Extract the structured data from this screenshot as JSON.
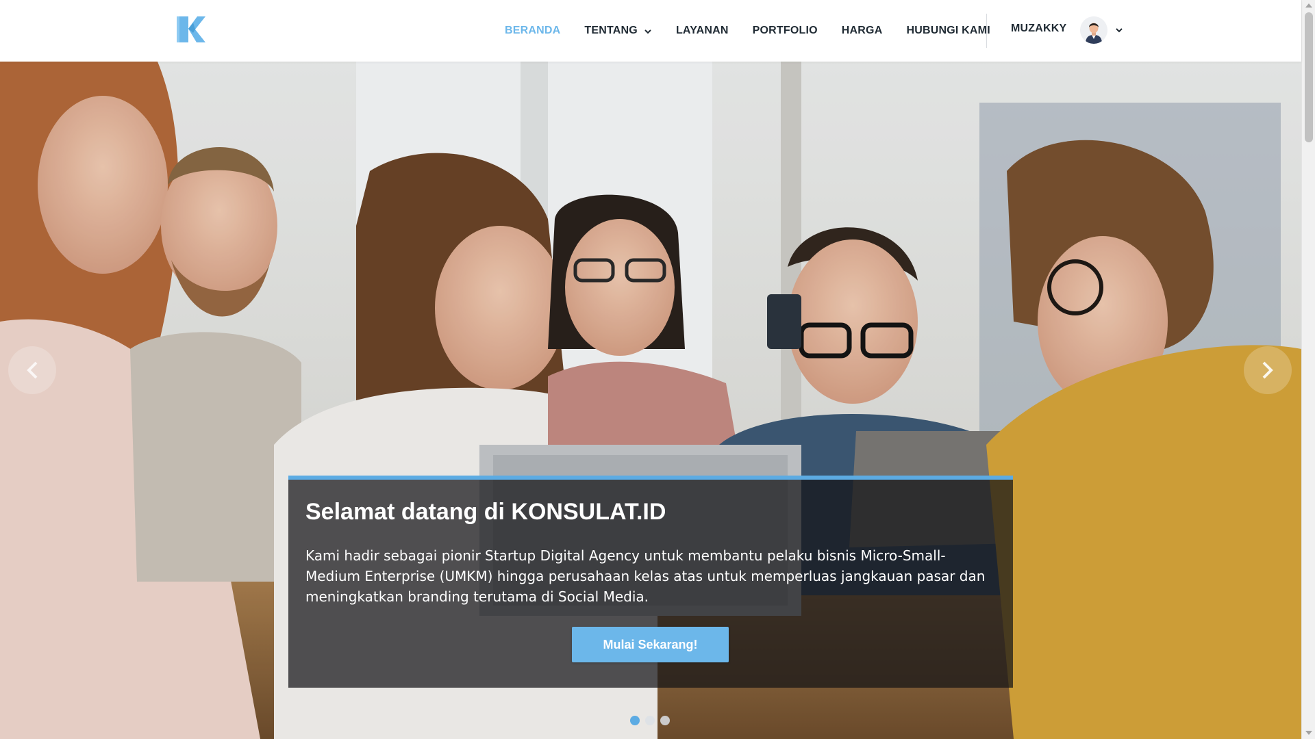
{
  "brand": {
    "logo_icon": "konsulat-k-logo",
    "accent_color": "#6cb7ea"
  },
  "nav": {
    "items": [
      {
        "label": "BERANDA",
        "active": true
      },
      {
        "label": "TENTANG",
        "has_dropdown": true
      },
      {
        "label": "LAYANAN"
      },
      {
        "label": "PORTFOLIO"
      },
      {
        "label": "HARGA"
      },
      {
        "label": "HUBUNGI KAMI"
      }
    ],
    "user": {
      "name": "MUZAKKY",
      "avatar_icon": "user-avatar",
      "menu_icon": "chevron-down-icon"
    }
  },
  "hero": {
    "background": "group-of-people-with-laptop-photo",
    "title": "Selamat datang di KONSULAT.ID",
    "text": "Kami hadir sebagai pionir Startup Digital Agency untuk membantu pelaku bisnis Micro-Small-Medium Enterprise (UMKM) hingga perusahaan kelas atas untuk memperluas jangkauan pasar dan meningkatkan branding terutama di Social Media.",
    "cta_label": "Mulai Sekarang!",
    "slide_count": 3,
    "active_slide": 1,
    "caption_border_color": "#5cabe3",
    "prev_icon": "chevron-left-icon",
    "next_icon": "chevron-right-icon"
  }
}
